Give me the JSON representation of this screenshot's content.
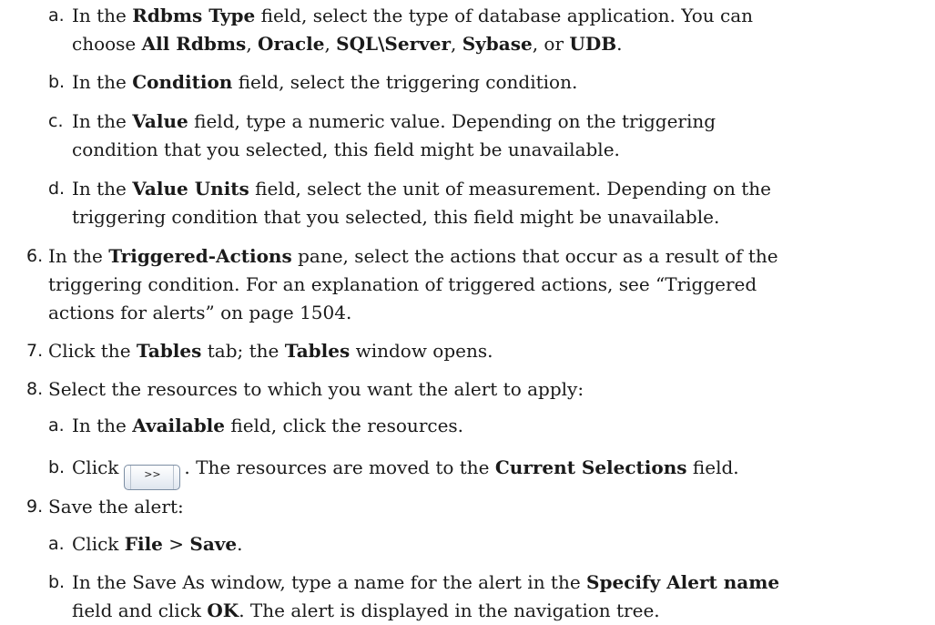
{
  "steps": {
    "s5a": {
      "marker": "a.",
      "t1": "In the ",
      "b1": "Rdbms Type",
      "t2": " field, select the type of database application. You can",
      "t3": "choose ",
      "b2": "All Rdbms",
      "t4": ", ",
      "b3": "Oracle",
      "t5": ", ",
      "b4": "SQL\\Server",
      "t6": ", ",
      "b5": "Sybase",
      "t7": ", or ",
      "b6": "UDB",
      "t8": "."
    },
    "s5b": {
      "marker": "b.",
      "t1": "In the ",
      "b1": "Condition",
      "t2": " field, select the triggering condition."
    },
    "s5c": {
      "marker": "c.",
      "t1": "In the ",
      "b1": "Value",
      "t2": " field, type a numeric value. Depending on the triggering",
      "t3": "condition that you selected, this field might be unavailable."
    },
    "s5d": {
      "marker": "d.",
      "t1": "In the ",
      "b1": "Value Units",
      "t2": " field, select the unit of measurement. Depending on the",
      "t3": "triggering condition that you selected, this field might be unavailable."
    },
    "s6": {
      "marker": "6.",
      "t1": "In the ",
      "b1": "Triggered-Actions",
      "t2": " pane, select the actions that occur as a result of the",
      "t3": "triggering condition. For an explanation of triggered actions, see “Triggered",
      "t4": "actions for alerts” on page 1504."
    },
    "s7": {
      "marker": "7.",
      "t1": "Click the ",
      "b1": "Tables",
      "t2": " tab; the ",
      "b2": "Tables",
      "t3": " window opens."
    },
    "s8": {
      "marker": "8.",
      "t1": "Select the resources to which you want the alert to apply:"
    },
    "s8a": {
      "marker": "a.",
      "t1": "In the ",
      "b1": "Available",
      "t2": " field, click the resources."
    },
    "s8b": {
      "marker": "b.",
      "t1": "Click",
      "button_label": ">>",
      "t2": ". The resources are moved to the ",
      "b1": "Current Selections",
      "t3": " field."
    },
    "s9": {
      "marker": "9.",
      "t1": "Save the alert:"
    },
    "s9a": {
      "marker": "a.",
      "t1": "Click ",
      "b1": "File",
      "t2": " > ",
      "b2": "Save",
      "t3": "."
    },
    "s9b": {
      "marker": "b.",
      "t1": "In the Save As window, type a name for the alert in the ",
      "b1": "Specify Alert name",
      "t2": "field and click ",
      "b2": "OK",
      "t3": ". The alert is displayed in the navigation tree."
    }
  }
}
